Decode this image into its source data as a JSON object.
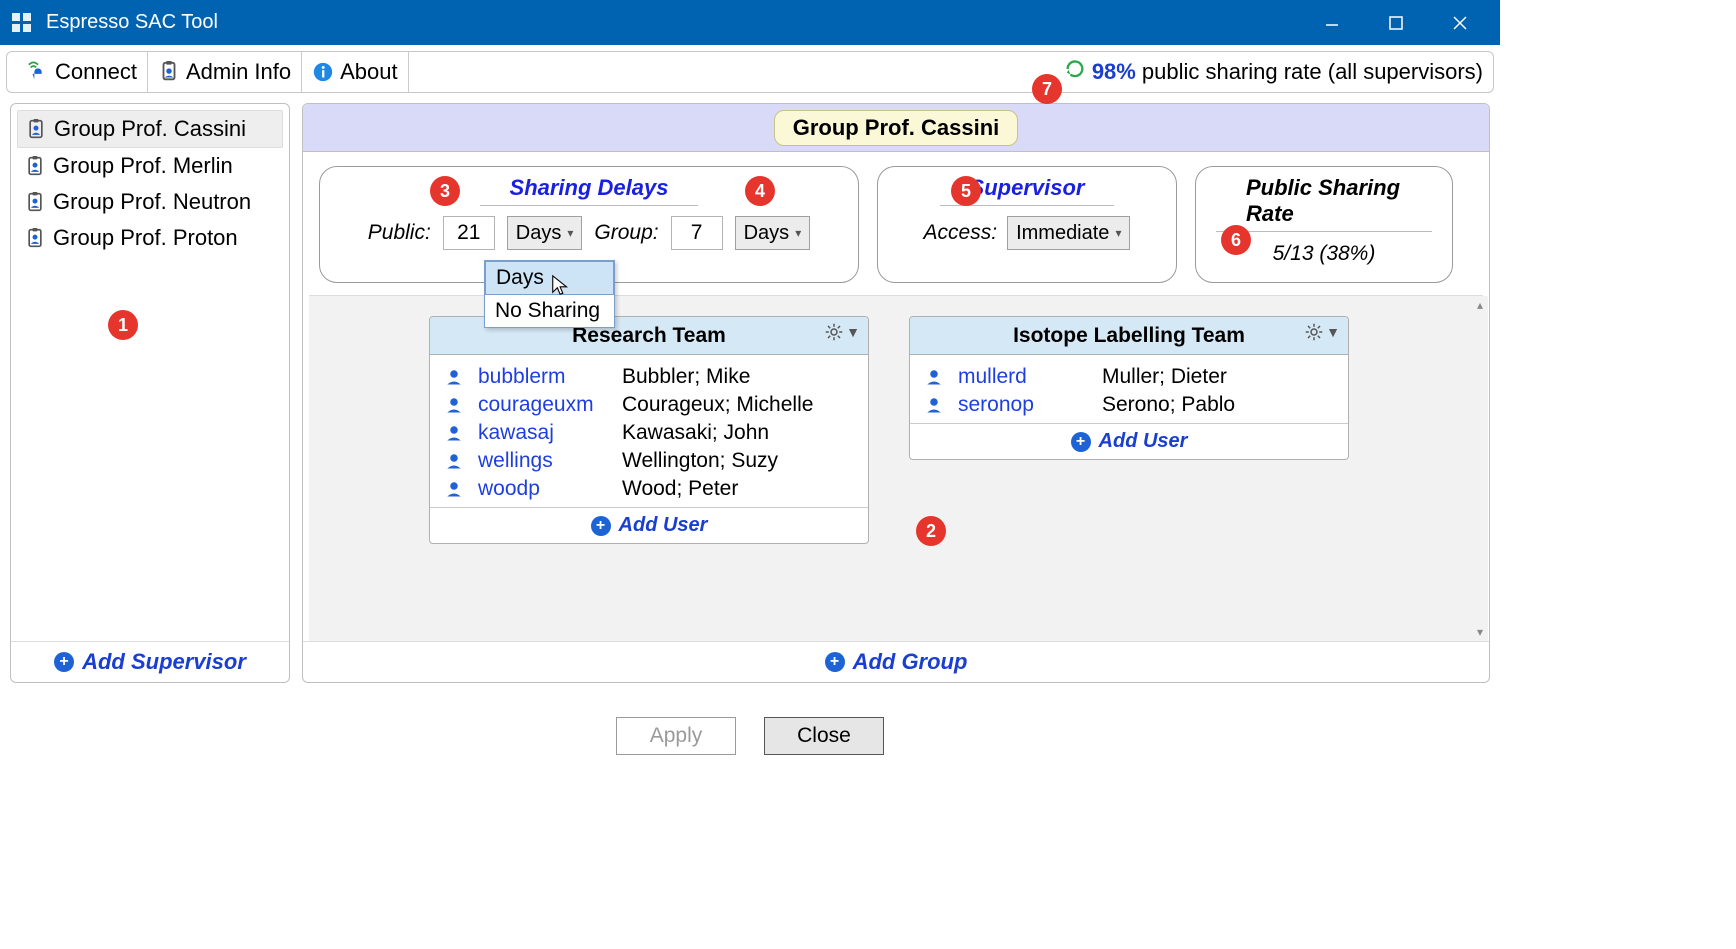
{
  "window": {
    "title": "Espresso SAC Tool"
  },
  "toolbar": {
    "connect": "Connect",
    "admin": "Admin Info",
    "about": "About",
    "rate_pct": "98%",
    "rate_text": "public sharing rate (all supervisors)"
  },
  "sidebar": {
    "items": [
      {
        "label": "Group Prof. Cassini",
        "selected": true
      },
      {
        "label": "Group Prof. Merlin",
        "selected": false
      },
      {
        "label": "Group Prof. Neutron",
        "selected": false
      },
      {
        "label": "Group Prof. Proton",
        "selected": false
      }
    ],
    "add": "Add Supervisor"
  },
  "group": {
    "title": "Group Prof. Cassini",
    "sharing_delays": {
      "title": "Sharing Delays",
      "public_label": "Public:",
      "public_value": "21",
      "public_unit": "Days",
      "group_label": "Group:",
      "group_value": "7",
      "group_unit": "Days",
      "dropdown": {
        "options": [
          "Days",
          "No Sharing"
        ],
        "highlight": 0
      }
    },
    "supervisor": {
      "title": "Supervisor",
      "access_label": "Access:",
      "access_value": "Immediate"
    },
    "psr": {
      "title": "Public Sharing Rate",
      "value": "5/13 (38%)"
    },
    "teams": [
      {
        "name": "Research Team",
        "users": [
          {
            "id": "bubblerm",
            "name": "Bubbler; Mike"
          },
          {
            "id": "courageuxm",
            "name": "Courageux; Michelle"
          },
          {
            "id": "kawasaj",
            "name": "Kawasaki; John"
          },
          {
            "id": "wellings",
            "name": "Wellington; Suzy"
          },
          {
            "id": "woodp",
            "name": "Wood; Peter"
          }
        ]
      },
      {
        "name": "Isotope Labelling Team",
        "users": [
          {
            "id": "mullerd",
            "name": "Muller; Dieter"
          },
          {
            "id": "seronop",
            "name": "Serono; Pablo"
          }
        ]
      }
    ],
    "add_user": "Add User",
    "add_group": "Add Group"
  },
  "footer": {
    "apply": "Apply",
    "close": "Close"
  },
  "callouts": [
    "1",
    "2",
    "3",
    "4",
    "5",
    "6",
    "7"
  ]
}
